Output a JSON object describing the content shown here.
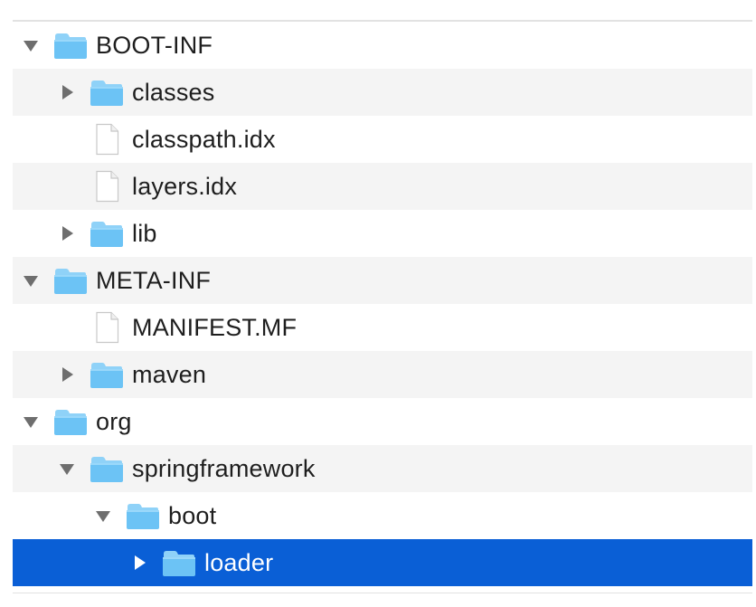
{
  "tree": {
    "rows": [
      {
        "label": "BOOT-INF",
        "depth": 0,
        "kind": "folder",
        "state": "expanded",
        "selected": false
      },
      {
        "label": "classes",
        "depth": 1,
        "kind": "folder",
        "state": "collapsed",
        "selected": false
      },
      {
        "label": "classpath.idx",
        "depth": 1,
        "kind": "file",
        "state": "none",
        "selected": false
      },
      {
        "label": "layers.idx",
        "depth": 1,
        "kind": "file",
        "state": "none",
        "selected": false
      },
      {
        "label": "lib",
        "depth": 1,
        "kind": "folder",
        "state": "collapsed",
        "selected": false
      },
      {
        "label": "META-INF",
        "depth": 0,
        "kind": "folder",
        "state": "expanded",
        "selected": false
      },
      {
        "label": "MANIFEST.MF",
        "depth": 1,
        "kind": "file",
        "state": "none",
        "selected": false
      },
      {
        "label": "maven",
        "depth": 1,
        "kind": "folder",
        "state": "collapsed",
        "selected": false
      },
      {
        "label": "org",
        "depth": 0,
        "kind": "folder",
        "state": "expanded",
        "selected": false
      },
      {
        "label": "springframework",
        "depth": 1,
        "kind": "folder",
        "state": "expanded",
        "selected": false
      },
      {
        "label": "boot",
        "depth": 2,
        "kind": "folder",
        "state": "expanded",
        "selected": false
      },
      {
        "label": "loader",
        "depth": 3,
        "kind": "folder",
        "state": "collapsed",
        "selected": true
      }
    ]
  },
  "colors": {
    "selection": "#0a5fd6",
    "folder": "#6cc3f5",
    "folder_tab": "#8fd2f8",
    "disclosure": "#6e6e6e",
    "alt_row": "#f4f4f4"
  },
  "icons": {
    "folder": "folder-icon",
    "file": "file-icon",
    "expanded": "disclosure-triangle-down-icon",
    "collapsed": "disclosure-triangle-right-icon"
  }
}
